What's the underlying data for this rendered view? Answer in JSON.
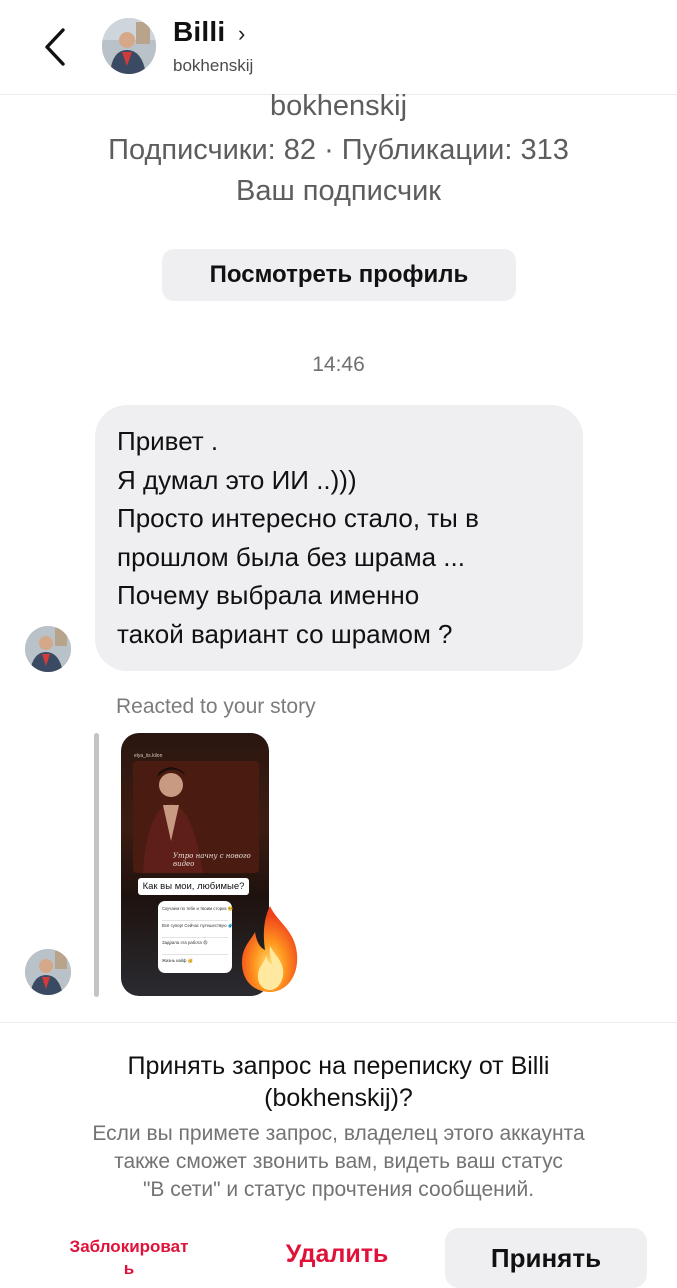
{
  "header": {
    "name": "Billi",
    "chevron": "›",
    "username": "bokhenskij"
  },
  "profile": {
    "username": "bokhenskij",
    "stats": "Подписчики: 82 · Публикации: 313",
    "follow_status": "Ваш подписчик",
    "view_profile_label": "Посмотреть профиль"
  },
  "chat": {
    "timestamp": "14:46",
    "message_lines": [
      "Привет .",
      "Я думал это ИИ ..)))",
      "Просто интересно стало, ты в",
      "прошлом была без шрама ...",
      "Почему выбрала именно",
      "такой вариант со шрамом ?"
    ],
    "reacted_label": "Reacted to your story",
    "reaction_emoji": "🔥",
    "story": {
      "handle": "elya_iis.kilon",
      "caption": "Утро начну с нового видео",
      "question": "Как вы мои, любимые?",
      "options": [
        "Скучаем по тебе и твоим сториз 🥺",
        "Всё супер! Сейчас путешествую 🧳",
        "Задрала эта работа 😩",
        "Жизнь кайф 🥳"
      ]
    }
  },
  "request": {
    "title_line1": "Принять запрос на переписку от Billi",
    "title_line2": "(bokhenskij)?",
    "desc_line1": "Если вы примете запрос, владелец этого аккаунта",
    "desc_line2": "также сможет звонить вам, видеть ваш статус",
    "desc_line3": "\"В сети\" и статус прочтения сообщений.",
    "block_label_line1": "Заблокироват",
    "block_label_line2": "ь",
    "delete_label": "Удалить",
    "accept_label": "Принять"
  },
  "colors": {
    "destructive": "#e0123a",
    "bubble": "#efeff2",
    "secondary_text": "#737373"
  },
  "icons": [
    "back-arrow-icon",
    "avatar",
    "fire-emoji"
  ]
}
